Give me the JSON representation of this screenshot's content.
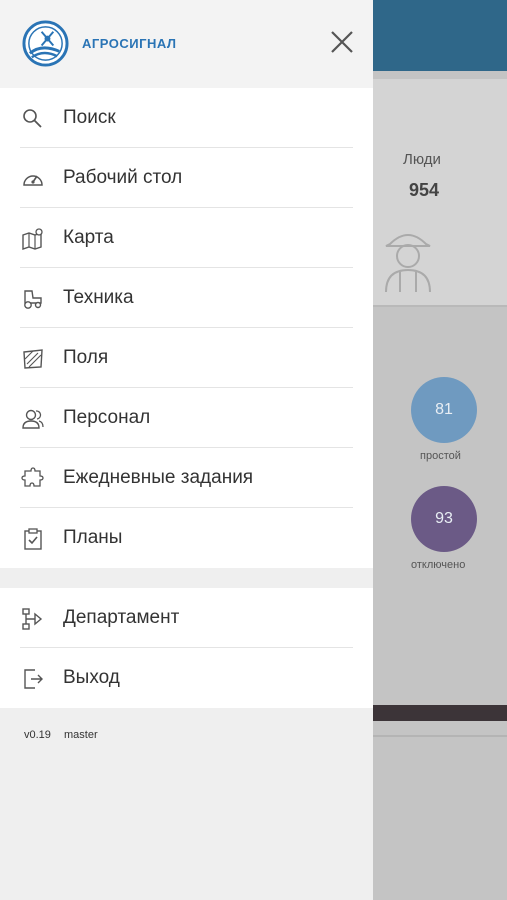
{
  "brand": {
    "name": "АГРОСИГНАЛ"
  },
  "menu": {
    "items": [
      {
        "label": "Поиск",
        "icon": "search-icon"
      },
      {
        "label": "Рабочий стол",
        "icon": "dashboard-icon"
      },
      {
        "label": "Карта",
        "icon": "map-icon"
      },
      {
        "label": "Техника",
        "icon": "tractor-icon"
      },
      {
        "label": "Поля",
        "icon": "fields-icon"
      },
      {
        "label": "Персонал",
        "icon": "people-icon"
      },
      {
        "label": "Ежедневные задания",
        "icon": "puzzle-icon"
      },
      {
        "label": "Планы",
        "icon": "clipboard-check-icon"
      }
    ],
    "secondary": [
      {
        "label": "Департамент",
        "icon": "department-icon"
      },
      {
        "label": "Выход",
        "icon": "logout-icon"
      }
    ]
  },
  "version": {
    "number": "v0.19",
    "branch": "master"
  },
  "background": {
    "people_label": "Люди",
    "people_value": "954",
    "stats": [
      {
        "value": "81",
        "caption": "простой",
        "color": "#5e8fb8"
      },
      {
        "value": "93",
        "caption": "отключено",
        "color": "#5e4d80"
      }
    ]
  },
  "colors": {
    "brand": "#2a74b5",
    "header": "#2f6789"
  }
}
